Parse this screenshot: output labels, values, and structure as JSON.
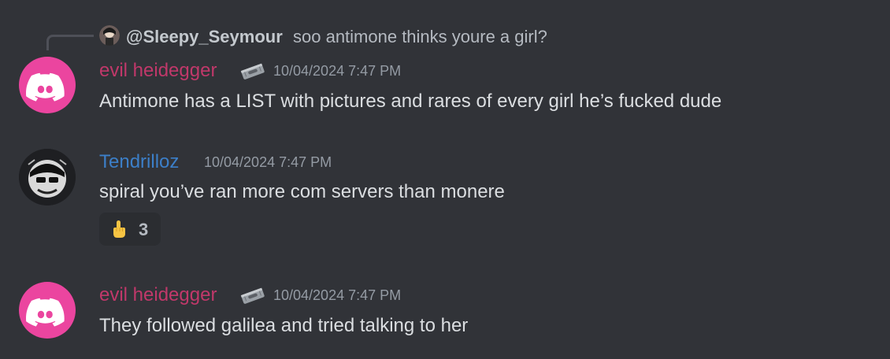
{
  "reply": {
    "name": "@Sleepy_Seymour",
    "text": "soo antimone thinks youre a girl?"
  },
  "messages": [
    {
      "username": "evil heidegger",
      "username_color": "#c1386a",
      "badge_icon": "razor-blade-icon",
      "timestamp": "10/04/2024 7:47 PM",
      "content": "Antimone has a LIST with pictures and rares of every girl he’s fucked dude"
    },
    {
      "username": "Tendrilloz",
      "username_color": "#3c7fc8",
      "timestamp": "10/04/2024 7:47 PM",
      "content": "spiral you’ve ran more com servers than monere",
      "reaction": {
        "emoji": "pointing-up-hand-emoji",
        "count": "3"
      }
    },
    {
      "username": "evil heidegger",
      "username_color": "#c1386a",
      "badge_icon": "razor-blade-icon",
      "timestamp": "10/04/2024 7:47 PM",
      "content": "They followed galilea and tried talking to her"
    }
  ],
  "colors": {
    "background": "#313338",
    "discord_avatar_bg": "#eb459f"
  }
}
